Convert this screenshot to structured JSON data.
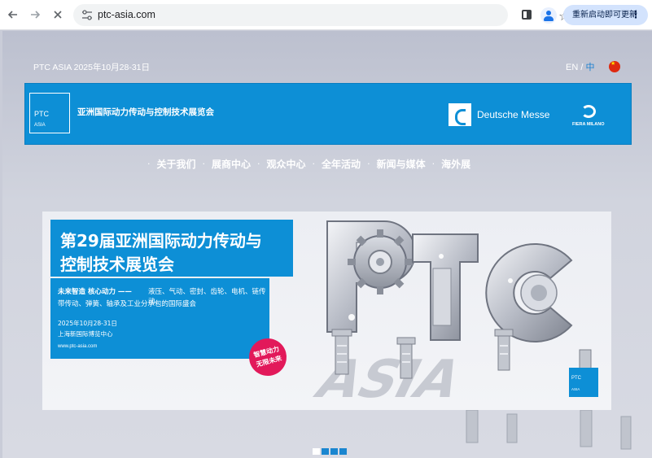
{
  "browser": {
    "nav_back_icon": "arrow-left-icon",
    "nav_forward_icon": "arrow-right-icon",
    "nav_stop_icon": "close-icon",
    "url": "ptc-asia.com",
    "update_label": "重新启动即可更新",
    "kebab": "⋮"
  },
  "topbar": {
    "event_date": "PTC ASIA 2025年10月28-31日",
    "lang_en": "EN",
    "lang_sep": " / ",
    "lang_zh": "中"
  },
  "header": {
    "logo_line1": "PTC",
    "logo_line2": "ASIA",
    "title": "亚洲国际动力传动与控制技术展览会",
    "partner1": "Deutsche Messe",
    "partner2": "FIERA MILANO"
  },
  "nav": {
    "dot": "·",
    "items": [
      {
        "label": "关于我们"
      },
      {
        "label": "展商中心"
      },
      {
        "label": "观众中心"
      },
      {
        "label": "全年活动"
      },
      {
        "label": "新闻与媒体"
      },
      {
        "label": "海外展"
      }
    ]
  },
  "banner": {
    "title_line1": "第29届亚洲国际动力传动与",
    "title_line2": "控制技术展览会",
    "lead": "未来智造  核心动力 ——",
    "desc_line1": "液压、气动、密封、齿轮、电机、链传动、",
    "desc_line2": "带传动、弹簧、轴承及工业分承包的国际盛会",
    "date": "2025年10月28-31日",
    "venue": "上海新国际博览中心",
    "website": "www.ptc-asia.com",
    "badge_line1": "智慧动力",
    "badge_line2": "无限未来",
    "mini_logo1": "PTC",
    "mini_logo2": "ASIA"
  },
  "colors": {
    "brand_blue": "#0d8fd6",
    "badge_pink": "#e2195a",
    "page_bg": "#c9ccd8"
  },
  "carousel": {
    "slides": 4,
    "active_index": 0
  }
}
